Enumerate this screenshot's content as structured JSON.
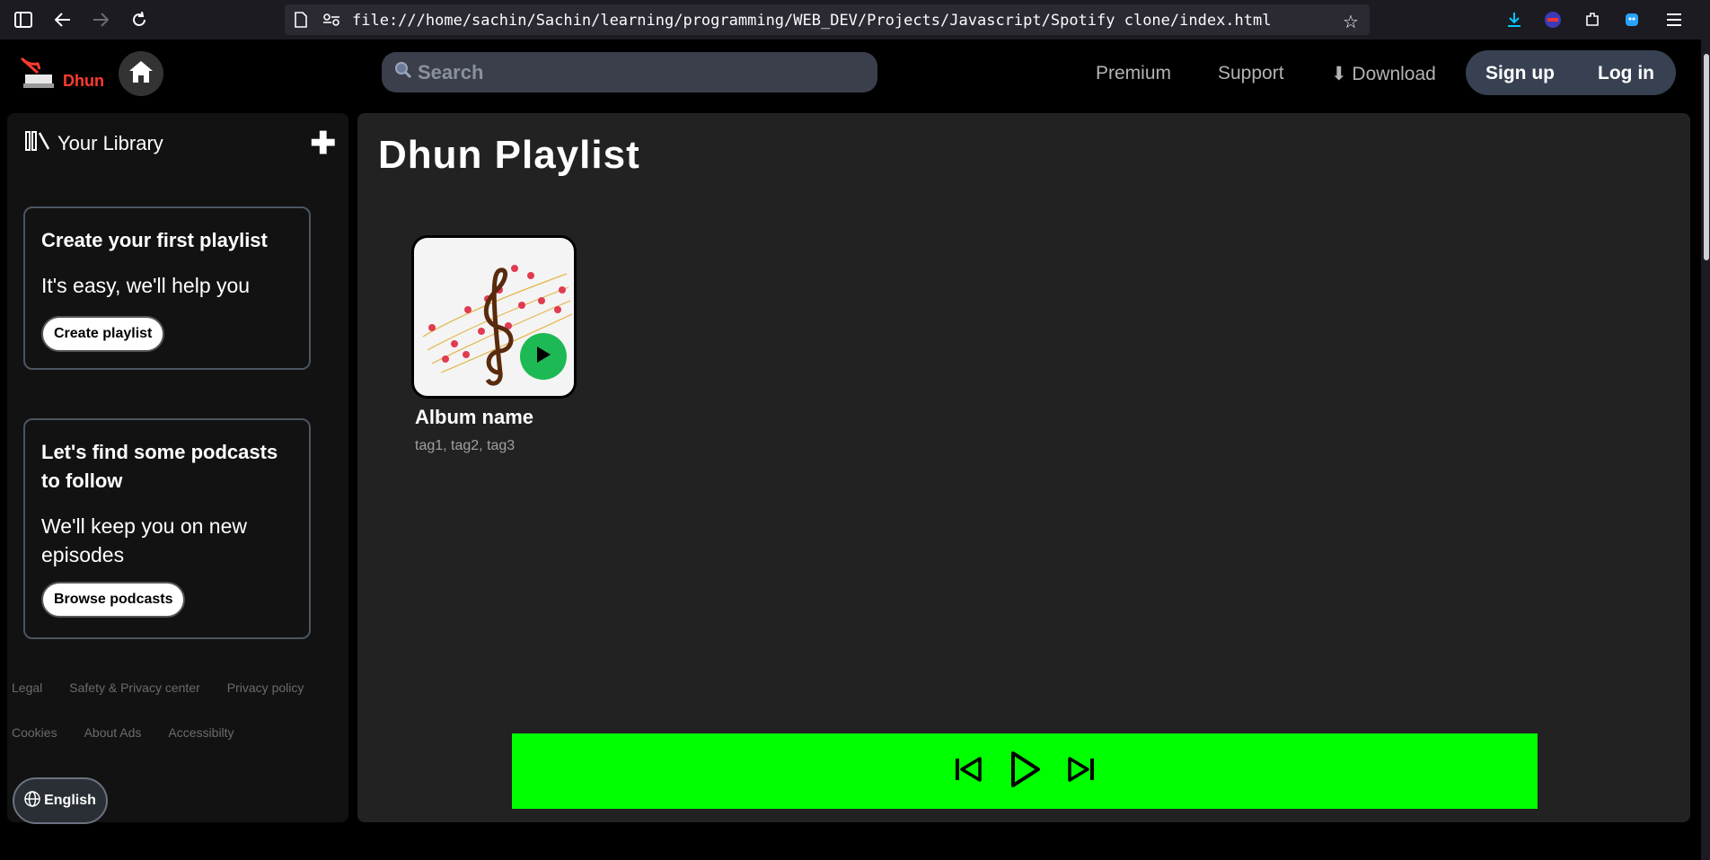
{
  "browser": {
    "url": "file:///home/sachin/Sachin/learning/programming/WEB_DEV/Projects/Javascript/Spotify clone/index.html"
  },
  "header": {
    "logo_text": "Dhun",
    "search_placeholder": "Search",
    "links": [
      "Premium",
      "Support",
      "⬇ Download"
    ],
    "signup_label": "Sign up",
    "login_label": "Log in"
  },
  "library": {
    "title": "Your Library",
    "cards": [
      {
        "title": "Create your first playlist",
        "subtitle": "It's easy, we'll help you",
        "button": "Create playlist"
      },
      {
        "title": "Let's find some podcasts to follow",
        "subtitle": "We'll keep you on new episodes",
        "button": "Browse podcasts"
      }
    ],
    "footer_row1": [
      "Legal",
      "Safety & Privacy center",
      "Privacy policy"
    ],
    "footer_row2": [
      "Cookies",
      "About Ads",
      "Accessibilty"
    ],
    "language": "English"
  },
  "main": {
    "title": "Dhun Playlist",
    "album": {
      "name": "Album name",
      "tags": "tag1, tag2, tag3"
    }
  },
  "colors": {
    "player_bar": "#00ff00",
    "play_button": "#1db954",
    "logo": "#ff3b30"
  }
}
